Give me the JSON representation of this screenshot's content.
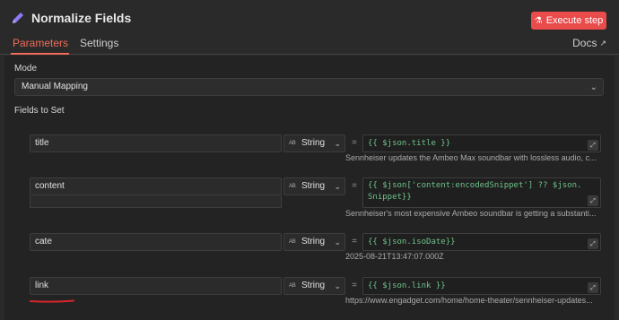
{
  "header": {
    "title": "Normalize Fields",
    "execute_button": "Execute step"
  },
  "tabs": {
    "parameters": "Parameters",
    "settings": "Settings",
    "docs": "Docs"
  },
  "mode": {
    "label": "Mode",
    "value": "Manual Mapping"
  },
  "fields_label": "Fields to Set",
  "fields": [
    {
      "name": "title",
      "type": "String",
      "type_badge": "AB",
      "expression": "{{ $json.title }}",
      "result": "Sennheiser updates the Ambeo Max soundbar with lossless audio, c..."
    },
    {
      "name": "content",
      "type": "String",
      "type_badge": "AB",
      "expression_line1": "{{ $json['content:encodedSnippet'] ?? $json.content",
      "expression_line2": "Snippet}}",
      "result": "Sennheiser's most expensive Ambeo soundbar is getting a substanti..."
    },
    {
      "name": "cate",
      "type": "String",
      "type_badge": "AB",
      "expression": "{{ $json.isoDate}}",
      "result": "2025-08-21T13:47:07.000Z"
    },
    {
      "name": "link",
      "type": "String",
      "type_badge": "AB",
      "expression": "{{ $json.link }}",
      "result": "https://www.engadget.com/home/home-theater/sennheiser-updates..."
    }
  ],
  "colors": {
    "accent": "#ea4b4b",
    "tab_active": "#ef6c5a",
    "expression": "#6fc38a",
    "pencil": "#8b7cf6"
  }
}
